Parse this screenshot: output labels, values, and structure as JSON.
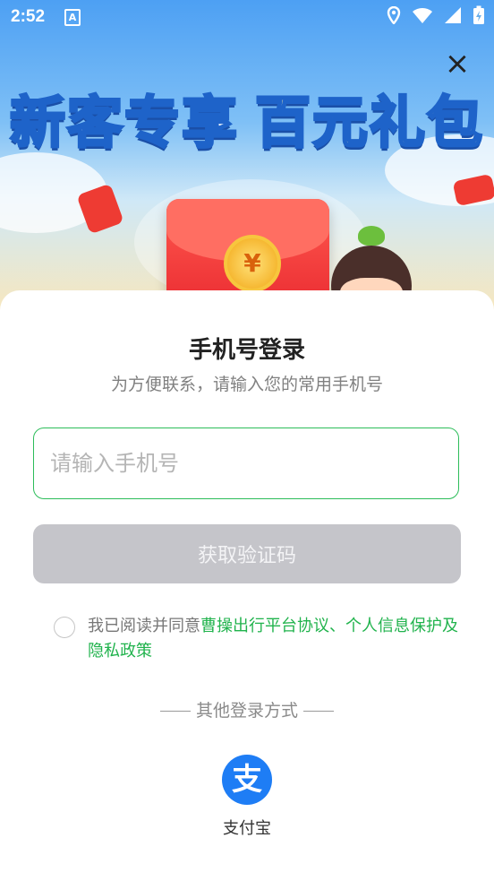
{
  "status_bar": {
    "time": "2:52",
    "notification_icon": "A"
  },
  "banner": {
    "title_part1": "新客专享",
    "title_part2": "百元礼包",
    "coin_symbol": "¥",
    "close_icon": "×"
  },
  "login": {
    "title": "手机号登录",
    "subtitle": "为方便联系，请输入您的常用手机号",
    "phone_placeholder": "请输入手机号",
    "get_code_label": "获取验证码",
    "agreement_prefix": "我已阅读并同意",
    "agreement_link1": "曹操出行平台协议",
    "agreement_sep": "、",
    "agreement_link2": "个人信息保护及隐私政策",
    "other_methods_label": "其他登录方式",
    "alipay_icon": "支",
    "alipay_label": "支付宝"
  },
  "colors": {
    "accent_green": "#21b34d",
    "alipay_blue": "#1e7df5",
    "button_disabled": "#c5c5ca"
  }
}
